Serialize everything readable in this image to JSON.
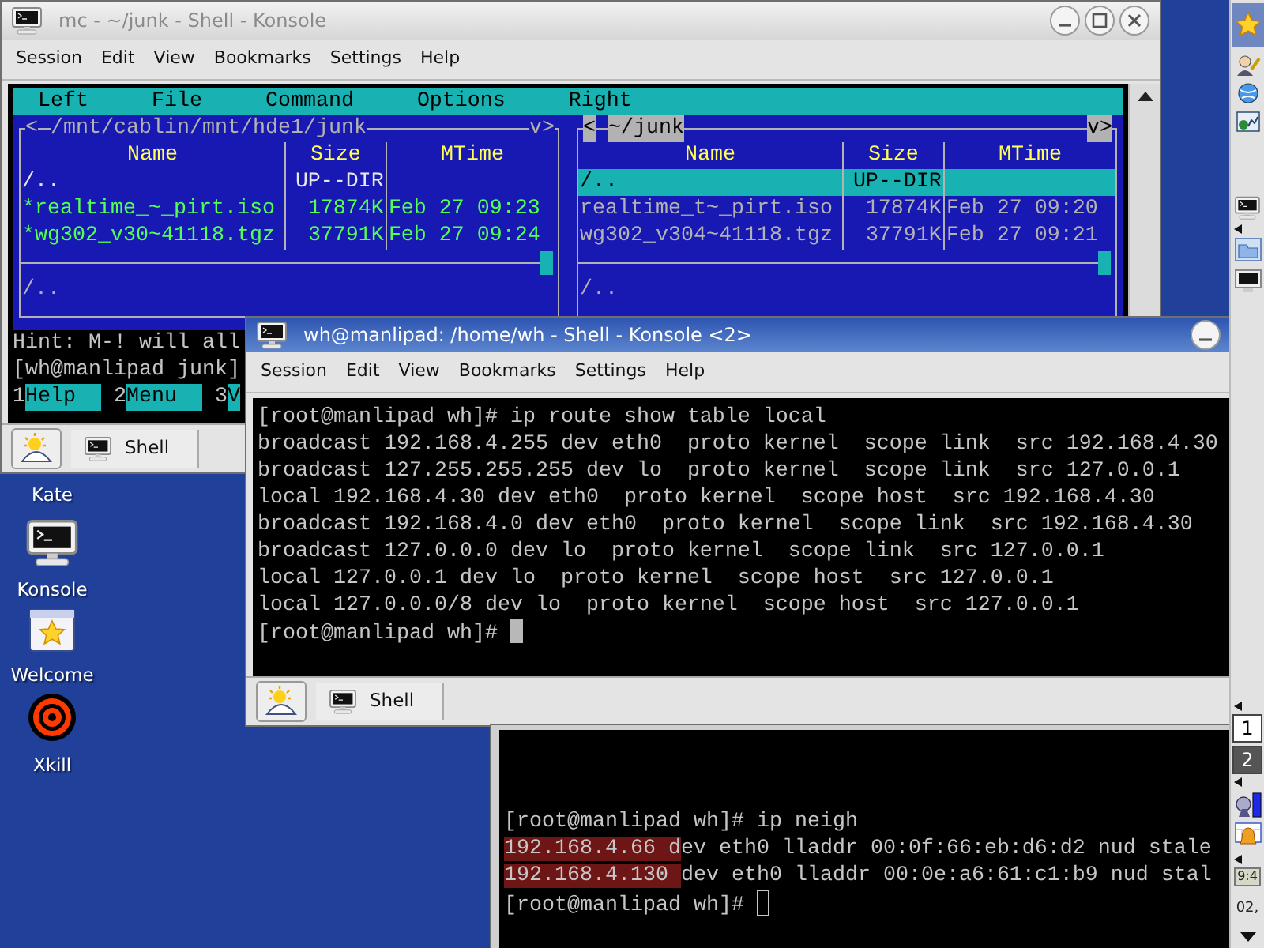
{
  "desktop_icons": [
    {
      "label": "Kate",
      "kind": "hidden"
    },
    {
      "label": "Konsole",
      "kind": "terminal"
    },
    {
      "label": "Welcome",
      "kind": "welcome"
    },
    {
      "label": "Xkill",
      "kind": "target"
    }
  ],
  "mc_window": {
    "title": "mc - ~/junk - Shell - Konsole",
    "active": false,
    "menu": [
      "Session",
      "Edit",
      "View",
      "Bookmarks",
      "Settings",
      "Help"
    ],
    "mc": {
      "menu": [
        "Left",
        "File",
        "Command",
        "Options",
        "Right"
      ],
      "panels": [
        {
          "left_mark": "<",
          "path": "/mnt/cablin/mnt/hde1/junk",
          "right_mark": "v>",
          "active": false,
          "columns": [
            "Name",
            "Size",
            "MTime"
          ],
          "rows": [
            {
              "name": "/..",
              "size": "UP--DIR",
              "kind": "dir",
              "selected": false
            },
            {
              "name": "*realtime_~_pirt.iso",
              "size": "17874K",
              "mtime": "Feb 27 09:23",
              "kind": "exec",
              "selected": false
            },
            {
              "name": "*wg302_v30~41118.tgz",
              "size": "37791K",
              "mtime": "Feb 27 09:24",
              "kind": "exec",
              "selected": false
            }
          ],
          "mini_status": "/.."
        },
        {
          "left_mark": "<",
          "path": "~/junk",
          "right_mark": "v>",
          "active": true,
          "columns": [
            "Name",
            "Size",
            "MTime"
          ],
          "rows": [
            {
              "name": "/..",
              "size": "UP--DIR",
              "kind": "dir",
              "selected": true
            },
            {
              "name": "realtime_t~_pirt.iso",
              "size": "17874K",
              "mtime": "Feb 27 09:20",
              "kind": "file",
              "selected": false
            },
            {
              "name": "wg302_v304~41118.tgz",
              "size": "37791K",
              "mtime": "Feb 27 09:21",
              "kind": "file",
              "selected": false
            }
          ],
          "mini_status": "/.."
        }
      ],
      "hint": "Hint: M-! will all",
      "prompt": "[wh@manlipad junk]",
      "keys": [
        {
          "number": "1",
          "label": "Help"
        },
        {
          "number": "2",
          "label": "Menu"
        },
        {
          "number": "3",
          "label": "V"
        }
      ]
    },
    "tabs": [
      {
        "label": "Shell",
        "selected": true
      }
    ]
  },
  "route_window": {
    "title": "wh@manlipad: /home/wh - Shell - Konsole <2>",
    "active": true,
    "menu": [
      "Session",
      "Edit",
      "View",
      "Bookmarks",
      "Settings",
      "Help"
    ],
    "lines": [
      "[root@manlipad wh]# ip route show table local",
      "broadcast 192.168.4.255 dev eth0  proto kernel  scope link  src 192.168.4.30",
      "broadcast 127.255.255.255 dev lo  proto kernel  scope link  src 127.0.0.1",
      "local 192.168.4.30 dev eth0  proto kernel  scope host  src 192.168.4.30",
      "broadcast 192.168.4.0 dev eth0  proto kernel  scope link  src 192.168.4.30",
      "broadcast 127.0.0.0 dev lo  proto kernel  scope link  src 127.0.0.1",
      "local 127.0.0.1 dev lo  proto kernel  scope host  src 127.0.0.1",
      "local 127.0.0.0/8 dev lo  proto kernel  scope host  src 127.0.0.1"
    ],
    "prompt": "[root@manlipad wh]# ",
    "tabs": [
      {
        "label": "Shell",
        "selected": true
      }
    ]
  },
  "neigh_window": {
    "active": false,
    "lines": [
      {
        "text": "[root@manlipad wh]# ip neigh"
      },
      {
        "highlight": "192.168.4.66 d",
        "text": "ev eth0 lladdr 00:0f:66:eb:d6:d2 nud stale"
      },
      {
        "highlight": "192.168.4.130 ",
        "text": "dev eth0 lladdr 00:0e:a6:61:c1:b9 nud stal"
      }
    ],
    "prompt": "[root@manlipad wh]# "
  },
  "panel": {
    "pager": [
      {
        "label": "1",
        "selected": false
      },
      {
        "label": "2",
        "selected": true
      }
    ],
    "clock": "9:4",
    "date": "02,"
  }
}
